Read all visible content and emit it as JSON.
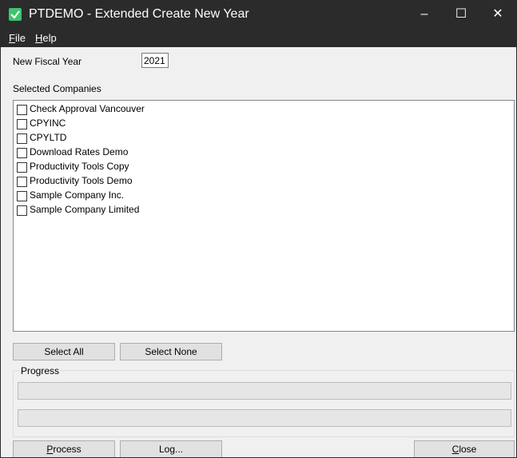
{
  "window": {
    "title": "PTDEMO - Extended Create New Year"
  },
  "titlebar": {
    "minimize": "–",
    "maximize": "☐",
    "close": "✕"
  },
  "menu": {
    "file": {
      "mnemonic": "F",
      "rest": "ile"
    },
    "help": {
      "mnemonic": "H",
      "rest": "elp"
    }
  },
  "form": {
    "fiscal_year_label": "New Fiscal Year",
    "fiscal_year_value": "2021",
    "companies_label": "Selected Companies"
  },
  "companies": [
    {
      "label": "Check Approval Vancouver",
      "checked": false
    },
    {
      "label": "CPYINC",
      "checked": false
    },
    {
      "label": "CPYLTD",
      "checked": false
    },
    {
      "label": "Download Rates Demo",
      "checked": false
    },
    {
      "label": "Productivity Tools Copy",
      "checked": false
    },
    {
      "label": "Productivity Tools Demo",
      "checked": false
    },
    {
      "label": "Sample Company Inc.",
      "checked": false
    },
    {
      "label": "Sample Company Limited",
      "checked": false
    }
  ],
  "buttons": {
    "select_all": "Select All",
    "select_none": "Select None",
    "process": {
      "mnemonic": "P",
      "rest": "rocess"
    },
    "log": "Log...",
    "close": {
      "mnemonic": "C",
      "rest": "lose"
    }
  },
  "progress": {
    "title": "Progress",
    "bar1_value": 0,
    "bar2_value": 0
  },
  "colors": {
    "titlebar": "#2b2b2b",
    "app_icon": "#3ec46d",
    "window_bg": "#f0f0f0"
  }
}
